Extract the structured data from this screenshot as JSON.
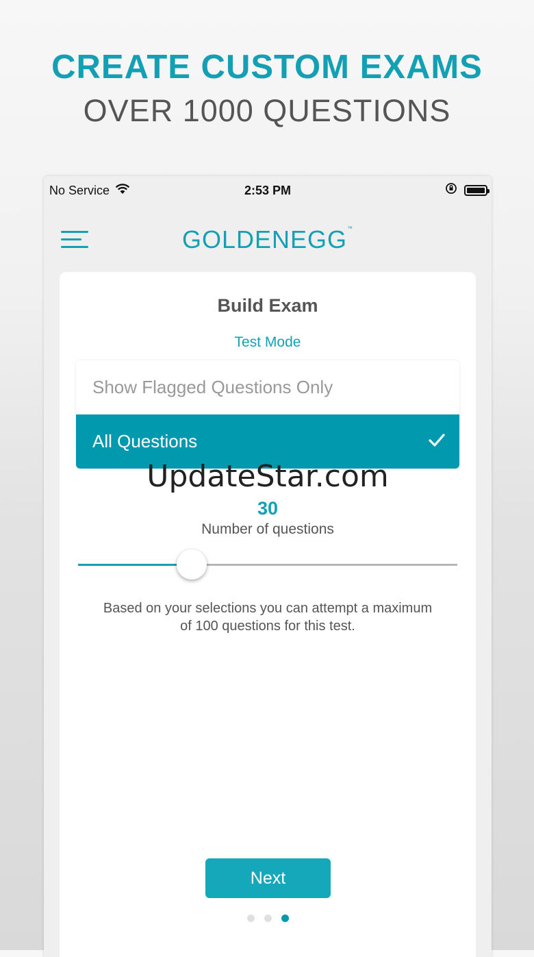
{
  "promo": {
    "headline": "CREATE CUSTOM EXAMS",
    "subheadline": "OVER 1000 QUESTIONS"
  },
  "status_bar": {
    "carrier": "No Service",
    "time": "2:53 PM",
    "icons": [
      "wifi-icon",
      "orientation-lock-icon",
      "battery-icon"
    ]
  },
  "nav": {
    "menu_icon": "hamburger-menu-icon",
    "logo_text": "GOLDENEGG",
    "logo_tm": "™"
  },
  "build": {
    "title": "Build Exam",
    "mode_link": "Test Mode",
    "options": [
      {
        "label": "Show Flagged Questions Only",
        "selected": false
      },
      {
        "label": "All Questions",
        "selected": true
      }
    ],
    "watermark": "UpdateStar.com",
    "question_count": "30",
    "question_count_label": "Number of questions",
    "slider": {
      "min": 0,
      "max": 100,
      "value": 30
    },
    "info_text": "Based on your selections you can attempt a maximum of 100 questions for this test.",
    "next_label": "Next"
  },
  "pagination": {
    "total": 3,
    "active": 3
  },
  "colors": {
    "accent": "#14a0b4",
    "selected_bg": "#0199ae",
    "button_bg": "#14a8ba"
  }
}
